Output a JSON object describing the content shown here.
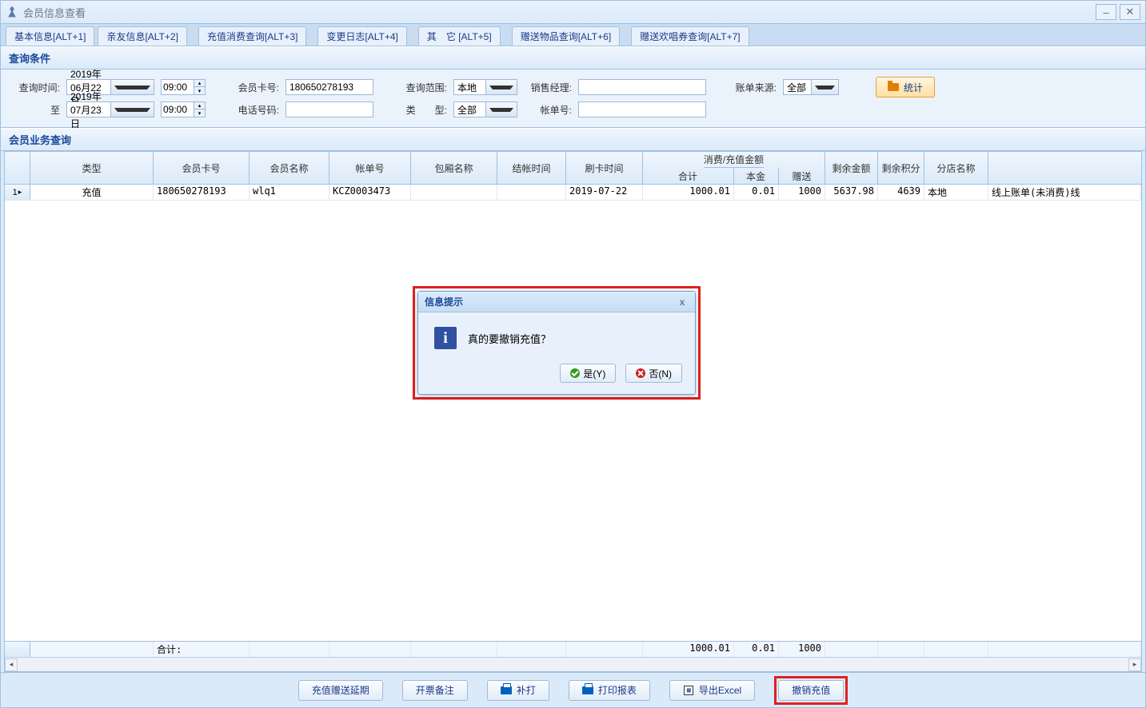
{
  "window": {
    "title": "会员信息查看"
  },
  "tabs": [
    "基本信息[ALT+1]",
    "亲友信息[ALT+2]",
    "充值消费查询[ALT+3]",
    "变更日志[ALT+4]",
    "其　它 [ALT+5]",
    "赠送物品查询[ALT+6]",
    "赠送欢唱券查询[ALT+7]"
  ],
  "sections": {
    "query_cond": "查询条件",
    "member_biz": "会员业务查询"
  },
  "filters": {
    "labels": {
      "query_time": "查询时间:",
      "to": "至",
      "card_no": "会员卡号:",
      "phone": "电话号码:",
      "scope": "查询范围:",
      "type": "类　　型:",
      "sales_mgr": "销售经理:",
      "bill_no": "帐单号:",
      "bill_src": "账单来源:"
    },
    "values": {
      "date_from": "2019年06月22日",
      "time_from": "09:00",
      "date_to": "2019年07月23日",
      "time_to": "09:00",
      "card_no": "180650278193",
      "phone": "",
      "scope": "本地",
      "type": "全部",
      "sales_mgr": "",
      "bill_no": "",
      "bill_src": "全部"
    },
    "stat_btn": "统计"
  },
  "grid": {
    "headers": {
      "type": "类型",
      "card": "会员卡号",
      "name": "会员名称",
      "bill": "帐单号",
      "room": "包厢名称",
      "settle": "结帐时间",
      "swipe": "刷卡时间",
      "amount_group": "消费/充值金额",
      "amt_total": "合计",
      "amt_principal": "本金",
      "amt_gift": "赠送",
      "balance": "剩余金额",
      "points": "剩余积分",
      "branch": "分店名称"
    },
    "row": {
      "idx": "1",
      "arrow": "▸",
      "type": "充值",
      "card": "180650278193",
      "name": "wlq1",
      "bill": "KCZ0003473",
      "room": "",
      "settle": "",
      "swipe": "2019-07-22",
      "amt_total": "1000.01",
      "amt_principal": "0.01",
      "amt_gift": "1000",
      "balance": "5637.98",
      "points": "4639",
      "branch": "本地",
      "extra": "线上账单(未消费)线"
    },
    "sum": {
      "label": "合计:",
      "amt_total": "1000.01",
      "amt_principal": "0.01",
      "amt_gift": "1000"
    }
  },
  "bottom_buttons": {
    "b1": "充值赠送延期",
    "b2": "开票备注",
    "b3": "补打",
    "b4": "打印报表",
    "b5": "导出Excel",
    "b6": "撤销充值"
  },
  "dialog": {
    "title": "信息提示",
    "message": "真的要撤销充值？",
    "yes": "是(Y)",
    "no": "否(N)"
  }
}
